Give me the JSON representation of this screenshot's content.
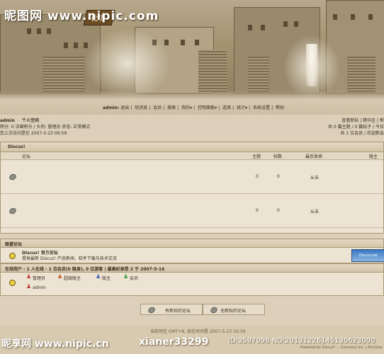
{
  "watermark": {
    "top_logo": "昵图网 www.nipic.com",
    "bottom_left": "昵享网 www.nipic.cn",
    "bottom_user": "xianer33299",
    "bottom_id": "ID:3597098 NO:20131226145130623000"
  },
  "banner": {
    "logo_mark": "社坊"
  },
  "nav": {
    "user": "admin:",
    "items": [
      "退出",
      "短消息",
      "会员",
      "搜索",
      "我的",
      "控制面板",
      "道具",
      "统计",
      "系统设置",
      "帮助"
    ]
  },
  "user_info": {
    "name": "admin",
    "space": "个人空间",
    "stats": "积分: 0 详细积分 / 头衔: 管理员 状态: 正常模式",
    "last_visit": "您上次访问是在 2007-5-23 09:59",
    "right_line1": "查看新帖 | 精华区 | 帮",
    "right_line2": "共 0 篇主题 / 0 篇帖子 / 今日",
    "right_line3": "共 1 位会员 / 欢迎新会"
  },
  "forum": {
    "category": "Discuz!",
    "columns": {
      "forum": "论坛",
      "topics": "主题",
      "posts": "帖数",
      "last_post": "最后发表",
      "moderator": "版主"
    },
    "rows": [
      {
        "topics": "0",
        "posts": "0",
        "last_post": "从未"
      },
      {
        "topics": "0",
        "posts": "0",
        "last_post": "从未"
      }
    ]
  },
  "alliance": {
    "title": "联盟论坛",
    "name": "Discuz! 官方论坛",
    "desc": "提供最新 Discuz! 产品新闻、软件下载与技术交流",
    "thumb": "Discuz.net"
  },
  "online": {
    "summary": "在线用户 - 1 人在线 - 1 位会员(0 隐身), 0 位游客 | 最高纪录是 2 于 2007-5-16",
    "roles": [
      "管理员",
      "超级版主",
      "版主",
      "会员"
    ],
    "users": [
      "admin"
    ]
  },
  "legend": {
    "new": "有新帖的论坛",
    "no_new": "无新帖的论坛"
  },
  "footer": {
    "timezone": "当前时区 GMT+8, 现在时间是 2007-5-23 10:39",
    "powered": "Powered by Discuz! ... Comsenz Inc. | Archiver"
  }
}
